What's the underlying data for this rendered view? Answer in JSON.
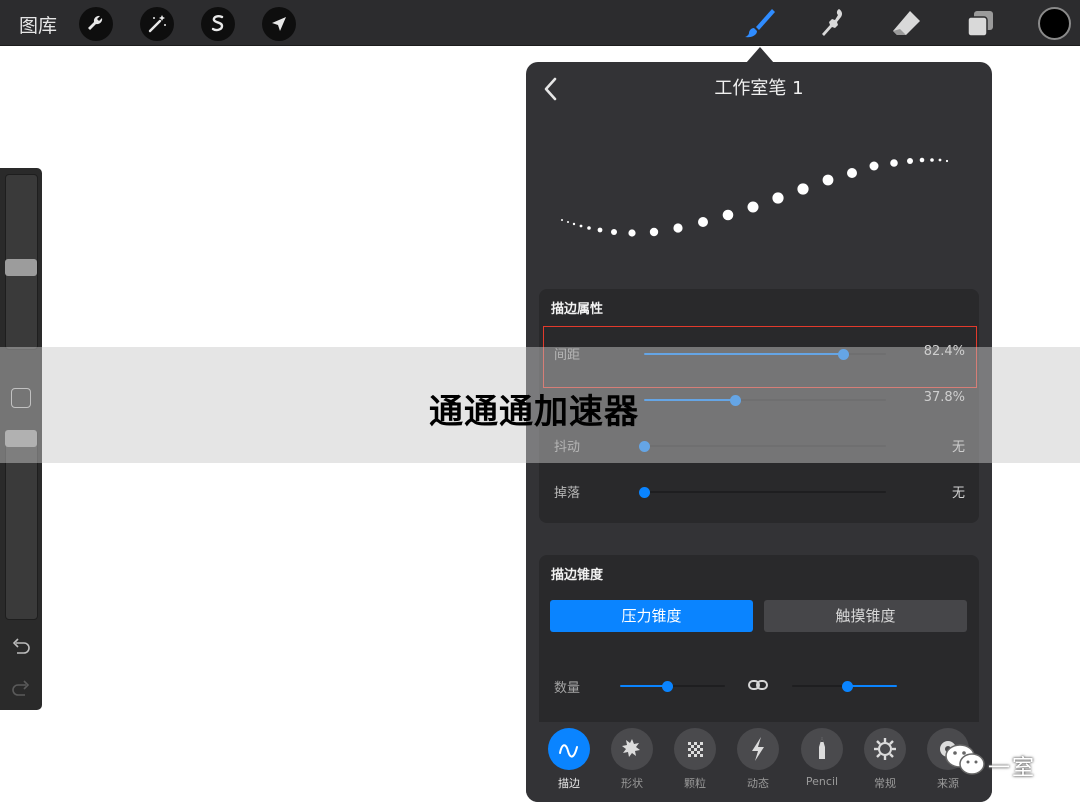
{
  "top_bar": {
    "gallery_label": "图库",
    "left_tools": [
      "wrench-icon",
      "magic-wand-icon",
      "selection-icon",
      "transform-arrow-icon"
    ],
    "right_tools": [
      "brush-icon",
      "smudge-icon",
      "eraser-icon",
      "layers-icon"
    ],
    "active_tool": "brush-icon",
    "current_color": "#000000"
  },
  "sidebar": {
    "size_slider_level": 0.2,
    "opacity_slider_level": 0.6,
    "modifier_icon": "square-icon",
    "undo_icon": "undo-icon",
    "redo_icon": "redo-icon"
  },
  "panel": {
    "title": "工作室笔 1",
    "back_icon": "chevron-left-icon",
    "stroke_properties": {
      "title": "描边属性",
      "rows": [
        {
          "label": "间距",
          "value": "82.4%",
          "level": 0.824
        },
        {
          "label": "",
          "value": "37.8%",
          "level": 0.378
        },
        {
          "label": "抖动",
          "value": "无",
          "level": 0
        },
        {
          "label": "掉落",
          "value": "无",
          "level": 0
        }
      ]
    },
    "stroke_taper": {
      "title": "描边锥度",
      "segments": [
        "压力锥度",
        "触摸锥度"
      ],
      "active_segment": 0,
      "amount_label": "数量",
      "amount_left_level": 0.45,
      "amount_right_level": 0.53,
      "link_icon": "link-icon"
    },
    "tabs": [
      {
        "label": "描边",
        "icon": "stroke-wave-icon"
      },
      {
        "label": "形状",
        "icon": "shape-burst-icon"
      },
      {
        "label": "颗粒",
        "icon": "grain-checker-icon"
      },
      {
        "label": "动态",
        "icon": "lightning-icon"
      },
      {
        "label": "Pencil",
        "icon": "pencil-tip-icon"
      },
      {
        "label": "常规",
        "icon": "gear-icon"
      },
      {
        "label": "来源",
        "icon": "source-icon"
      }
    ],
    "active_tab": 0
  },
  "watermark": {
    "overlay_text": "通通通加速器",
    "channel_name": "一室",
    "channel_icon": "wechat-icon"
  },
  "colors": {
    "accent": "#0a84ff",
    "panel_bg": "#333336",
    "highlight_border": "#e23a2c"
  }
}
